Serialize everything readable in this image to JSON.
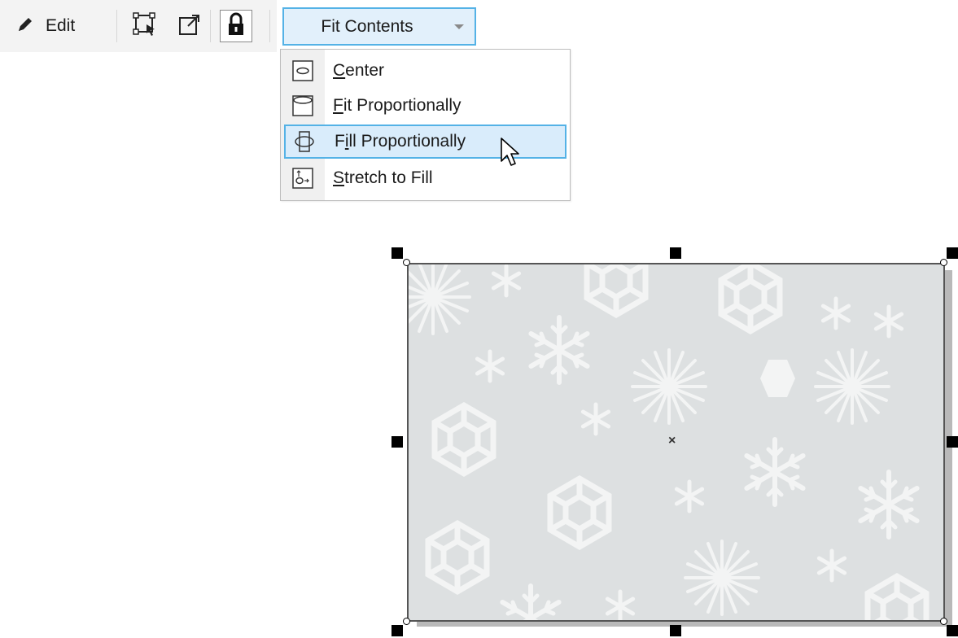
{
  "toolbar": {
    "edit_label": "Edit",
    "edit_icon": "pencil-icon",
    "icons": [
      "frame-select-icon",
      "extract-contents-icon",
      "lock-icon"
    ]
  },
  "fit_select": {
    "value": "Fit Contents",
    "arrow_icon": "chevron-down-icon",
    "accent": "#54b2e6"
  },
  "menu": {
    "items": [
      {
        "label_access": "C",
        "label_rest": "enter",
        "icon": "center-icon"
      },
      {
        "label_access": "F",
        "label_rest": "it Proportionally",
        "icon": "fit-proportionally-icon"
      },
      {
        "label_pre": "F",
        "label_access": "i",
        "label_rest": "ll Proportionally",
        "icon": "fill-proportionally-icon",
        "hovered": true
      },
      {
        "label_access": "S",
        "label_rest": "tretch to Fill",
        "icon": "stretch-to-fill-icon"
      }
    ]
  },
  "canvas": {
    "frame_fill": "#dde0e1",
    "pattern": "snowflakes"
  }
}
